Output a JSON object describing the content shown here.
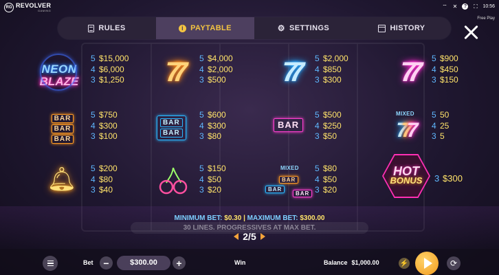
{
  "brand": {
    "logo_mark": "RG",
    "name": "REVOLVER",
    "subtitle": "GAMING"
  },
  "status_bar": {
    "time": "10:56",
    "wifi_icon": "wifi-icon",
    "mute_icon": "mute-icon",
    "help_icon": "?",
    "fullscreen_icon": "fullscreen-icon"
  },
  "mode_label": "Free Play",
  "tabs": [
    {
      "label": "RULES",
      "icon": "rules-icon",
      "active": false
    },
    {
      "label": "PAYTABLE",
      "icon": "info-icon",
      "active": true
    },
    {
      "label": "SETTINGS",
      "icon": "gear-icon",
      "active": false
    },
    {
      "label": "HISTORY",
      "icon": "history-icon",
      "active": false
    }
  ],
  "paytable": {
    "neon_blaze": {
      "line1": "NEON",
      "line2": "BLAZE",
      "pays": [
        {
          "n": "5",
          "v": "$15,000"
        },
        {
          "n": "4",
          "v": "$6,000"
        },
        {
          "n": "3",
          "v": "$1,250"
        }
      ]
    },
    "seven_orange": {
      "pays": [
        {
          "n": "5",
          "v": "$4,000"
        },
        {
          "n": "4",
          "v": "$2,000"
        },
        {
          "n": "3",
          "v": "$500"
        }
      ]
    },
    "seven_blue": {
      "pays": [
        {
          "n": "5",
          "v": "$2,000"
        },
        {
          "n": "4",
          "v": "$850"
        },
        {
          "n": "3",
          "v": "$300"
        }
      ]
    },
    "seven_pink": {
      "pays": [
        {
          "n": "5",
          "v": "$900"
        },
        {
          "n": "4",
          "v": "$450"
        },
        {
          "n": "3",
          "v": "$150"
        }
      ]
    },
    "triple_bar_orange": {
      "bar_text": "BAR",
      "pays": [
        {
          "n": "5",
          "v": "$750"
        },
        {
          "n": "4",
          "v": "$300"
        },
        {
          "n": "3",
          "v": "$100"
        }
      ]
    },
    "double_bar_blue": {
      "bar_text": "BAR",
      "pays": [
        {
          "n": "5",
          "v": "$600"
        },
        {
          "n": "4",
          "v": "$300"
        },
        {
          "n": "3",
          "v": "$80"
        }
      ]
    },
    "single_bar_pink": {
      "bar_text": "BAR",
      "pays": [
        {
          "n": "5",
          "v": "$500"
        },
        {
          "n": "4",
          "v": "$250"
        },
        {
          "n": "3",
          "v": "$50"
        }
      ]
    },
    "mixed_sevens": {
      "label": "MIXED",
      "pays": [
        {
          "n": "5",
          "v": "50"
        },
        {
          "n": "4",
          "v": "25"
        },
        {
          "n": "3",
          "v": "5"
        }
      ]
    },
    "bell": {
      "pays": [
        {
          "n": "5",
          "v": "$200"
        },
        {
          "n": "4",
          "v": "$80"
        },
        {
          "n": "3",
          "v": "$40"
        }
      ]
    },
    "cherry": {
      "pays": [
        {
          "n": "5",
          "v": "$150"
        },
        {
          "n": "4",
          "v": "$50"
        },
        {
          "n": "3",
          "v": "$20"
        }
      ]
    },
    "mixed_bars": {
      "label": "MIXED",
      "bar_text": "BAR",
      "pays": [
        {
          "n": "5",
          "v": "$80"
        },
        {
          "n": "4",
          "v": "$50"
        },
        {
          "n": "3",
          "v": "$20"
        }
      ]
    },
    "hot_bonus": {
      "line1": "HOT",
      "line2": "BONUS",
      "pays": [
        {
          "n": "3",
          "v": "$300"
        }
      ]
    }
  },
  "bet_limits": {
    "min_label": "MINIMUM BET:",
    "min_value": "$0.30",
    "separator": "|",
    "max_label": "MAXIMUM BET:",
    "max_value": "$300.00"
  },
  "lines_text": "30 LINES. PROGRESSIVES AT MAX BET.",
  "pagination": {
    "label": "2/5"
  },
  "controls": {
    "bet_label": "Bet",
    "bet_minus": "−",
    "bet_value": "$300.00",
    "bet_plus": "+",
    "win_label": "Win",
    "balance_label": "Balance",
    "balance_value": "$1,000.00"
  },
  "colors": {
    "accent": "#f3c441",
    "payout": "#ffe36a",
    "count": "#5fb8ff",
    "tab_bg": "#2b2338",
    "tab_active_bg": "#4d3f5f",
    "spin": "#f29a1c"
  }
}
